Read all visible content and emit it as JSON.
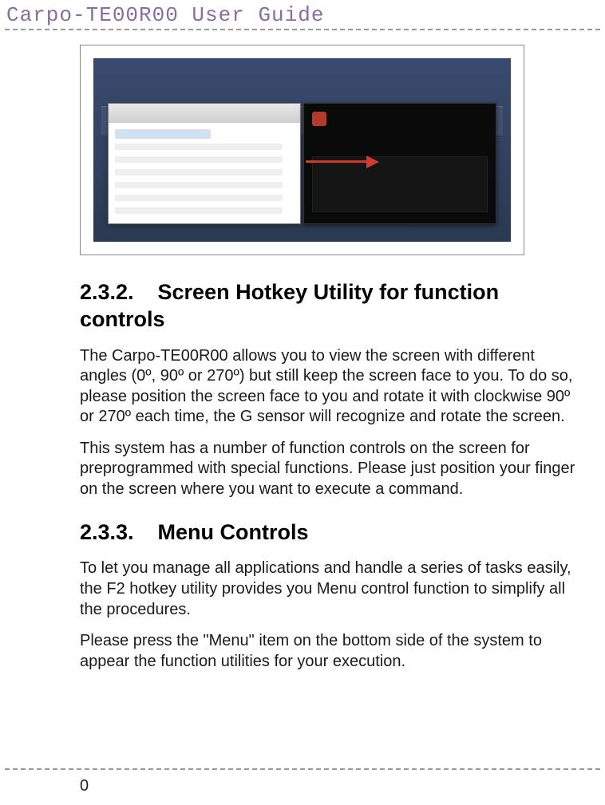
{
  "header": {
    "title": "Carpo-TE00R00  User  Guide"
  },
  "sections": {
    "s232": {
      "number": "2.3.2.",
      "title": "Screen Hotkey Utility for function controls",
      "p1": "The Carpo-TE00R00 allows you to view the screen with different angles (0º, 90º or 270º) but still keep the screen face to you. To do so, please position the screen face to you and rotate it with clockwise 90º or 270º each time, the G sensor will recognize and rotate the screen.",
      "p2": "This system has a number of function controls on the screen for preprogrammed with special functions. Please just position your finger on the screen where you want to execute a command."
    },
    "s233": {
      "number": "2.3.3.",
      "title": "Menu Controls",
      "p1": "To let you manage all applications and handle a series of tasks easily, the F2 hotkey utility provides you Menu control function to simplify all the procedures.",
      "p2": "Please press the \"Menu\" item on the bottom side of the system to appear the function utilities for your execution."
    }
  },
  "figure": {
    "alt": "screen-rotation-illustration",
    "left_panel": "browser-window",
    "right_panel": "dark-launcher-window",
    "arrow": "red-right-arrow"
  },
  "page_number": "0"
}
